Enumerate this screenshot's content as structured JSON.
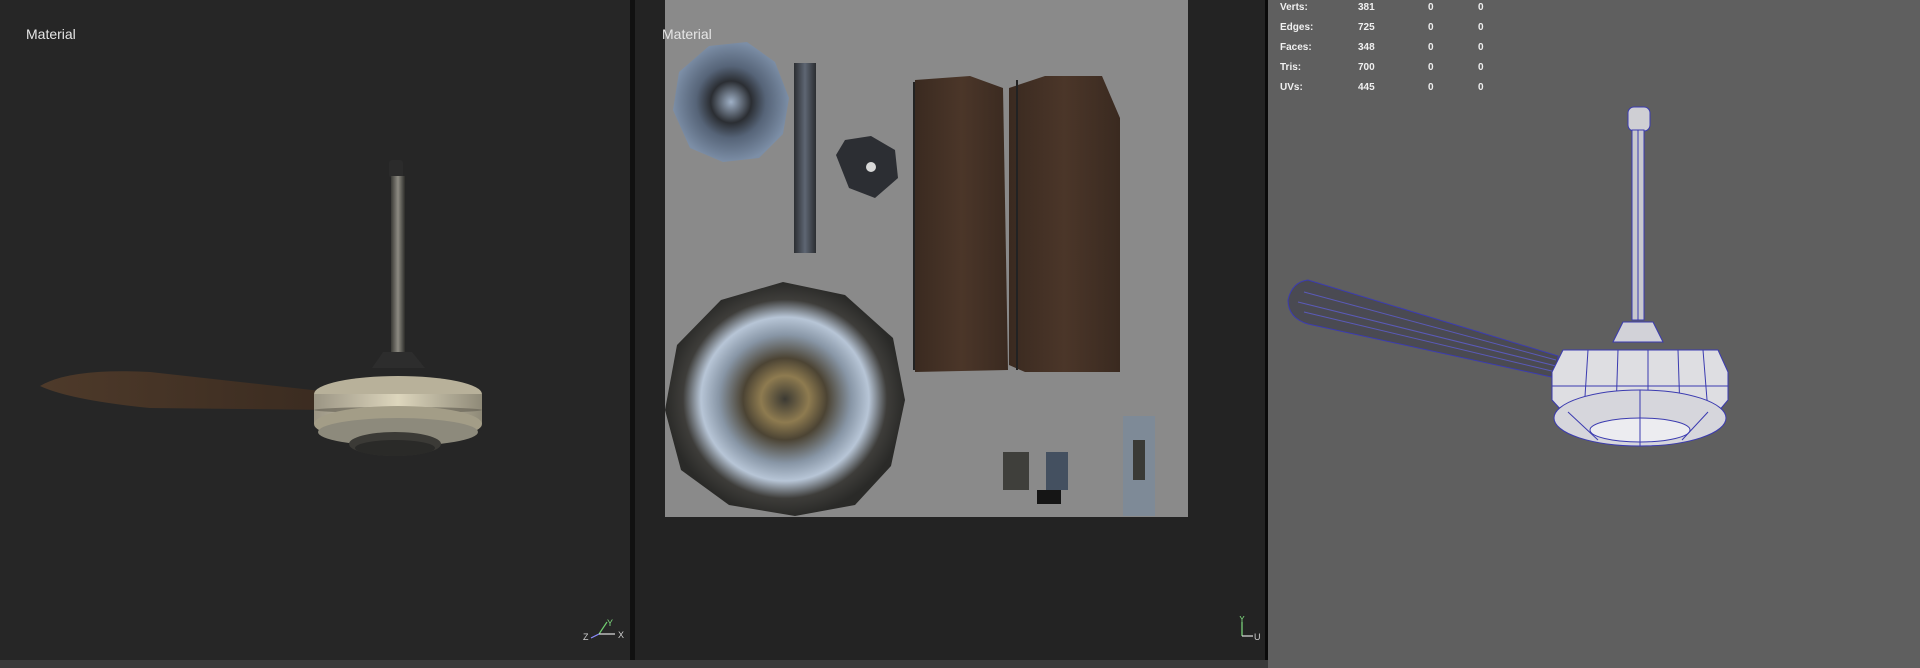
{
  "viewports": {
    "left": {
      "label": "Material",
      "axes": {
        "z": "Z",
        "y": "Y",
        "x": "X"
      }
    },
    "middle": {
      "label": "Material",
      "axes": {
        "y": "Y",
        "u": "U"
      }
    },
    "right": {
      "stats": [
        {
          "name": "Verts:",
          "total": "381",
          "selected": "0",
          "other": "0"
        },
        {
          "name": "Edges:",
          "total": "725",
          "selected": "0",
          "other": "0"
        },
        {
          "name": "Faces:",
          "total": "348",
          "selected": "0",
          "other": "0"
        },
        {
          "name": "Tris:",
          "total": "700",
          "selected": "0",
          "other": "0"
        },
        {
          "name": "UVs:",
          "total": "445",
          "selected": "0",
          "other": "0"
        }
      ]
    }
  },
  "colors": {
    "viewport_dark": "#262626",
    "viewport_grey": "#5f5f5f",
    "uv_background": "#8a8a8a",
    "wood": "#4a3528",
    "wireframe": "#3b3bb0"
  },
  "icons": [
    "axis-triad-icon",
    "uv-axis-icon",
    "ceiling-fan-model",
    "uv-texture-sheet",
    "wireframe-fan-model"
  ]
}
